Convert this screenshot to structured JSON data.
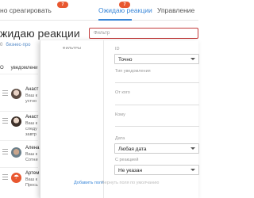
{
  "tabs": [
    {
      "label": "но среагировать",
      "badge": "7"
    },
    {
      "label": "Ожидаю реакции",
      "badge": "7",
      "active": true
    },
    {
      "label": "Управление"
    }
  ],
  "page": {
    "title": "жидаю реакции"
  },
  "filter": {
    "placeholder": "Фильтр"
  },
  "left": {
    "tag_count": "0",
    "tag_label": "бизнес-про",
    "header_o": "О",
    "header_col": "уведомлени",
    "items": [
      {
        "name": "Анаст",
        "l1": "Ваш к",
        "l2": "устно",
        "l3": ""
      },
      {
        "name": "Анаст",
        "l1": "Ваш к",
        "l2": "следу",
        "l3": "завтр"
      },
      {
        "name": "Алена",
        "l1": "Ваш к",
        "l2": "Сотни",
        "l3": ""
      },
      {
        "name": "Артем",
        "l1": "Ваш к",
        "l2": "Прось",
        "l3": ""
      }
    ]
  },
  "panel": {
    "presets_label": "ФИЛЬТРЫ",
    "fields": {
      "id_label": "ID",
      "id_value": "Точно",
      "type_label": "Тип уведомления",
      "from_label": "От кого",
      "to_label": "Кому",
      "date_label": "Дата",
      "date_value": "Любая дата",
      "reaction_label": "С реакцией",
      "reaction_value": "Не указан"
    },
    "add_field": "Добавить поле",
    "reset_fields": "Вернуть поля по умолчанию"
  },
  "colors": {
    "accent": "#3a87d8",
    "badge": "#e8572f",
    "filter_border": "#c23a3a"
  }
}
